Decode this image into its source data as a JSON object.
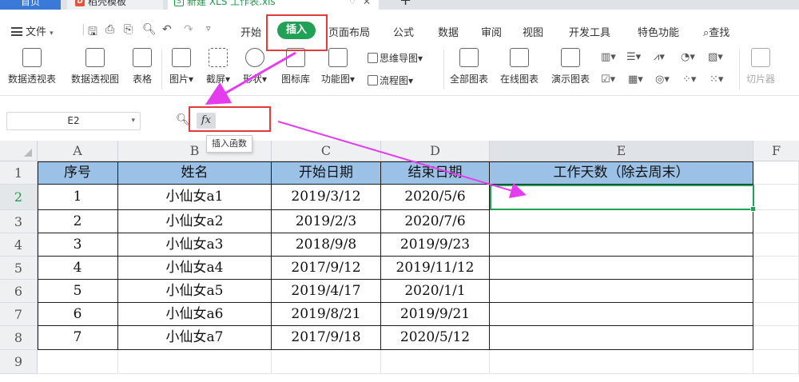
{
  "tabs": {
    "home": "首页",
    "template": "稻壳模板",
    "file": "新建 XLS 工作表.xls",
    "template_logo": "D",
    "file_logo": "S"
  },
  "menu": {
    "file": "文件",
    "items": [
      "开始",
      "插入",
      "页面布局",
      "公式",
      "数据",
      "审阅",
      "视图",
      "开发工具",
      "特色功能",
      "查找"
    ],
    "active": "插入"
  },
  "ribbon": {
    "pivot_table": "数据透视表",
    "pivot_chart": "数据透视图",
    "table": "表格",
    "picture": "图片",
    "screenshot": "截屏",
    "shape": "形状",
    "icon_lib": "图标库",
    "function_chart": "功能图",
    "mind_map": "思维导图",
    "flow_chart": "流程图",
    "all_charts": "全部图表",
    "online_charts": "在线图表",
    "demo_charts": "演示图表",
    "slicer": "切片器"
  },
  "formula_bar": {
    "cell_ref": "E2",
    "fx_label": "fx",
    "formula": "",
    "tooltip": "插入函数"
  },
  "columns": [
    "A",
    "B",
    "C",
    "D",
    "E",
    "F"
  ],
  "rows": [
    "1",
    "2",
    "3",
    "4",
    "5",
    "6",
    "7",
    "8",
    "9"
  ],
  "sheet": {
    "headers": [
      "序号",
      "姓名",
      "开始日期",
      "结束日期",
      "工作天数（除去周末）"
    ],
    "data": [
      [
        "1",
        "小仙女a1",
        "2019/3/12",
        "2020/5/6",
        ""
      ],
      [
        "2",
        "小仙女a2",
        "2019/2/3",
        "2020/7/6",
        ""
      ],
      [
        "3",
        "小仙女a3",
        "2018/9/8",
        "2019/9/23",
        ""
      ],
      [
        "4",
        "小仙女a4",
        "2017/9/12",
        "2019/11/12",
        ""
      ],
      [
        "5",
        "小仙女a5",
        "2019/4/17",
        "2020/1/1",
        ""
      ],
      [
        "6",
        "小仙女a6",
        "2019/8/21",
        "2019/9/21",
        ""
      ],
      [
        "7",
        "小仙女a7",
        "2017/9/18",
        "2020/5/12",
        ""
      ]
    ]
  },
  "selected_cell": "E2",
  "colors": {
    "accent": "#21a155",
    "highlight_box": "#e23b3b",
    "annotation_arrow": "#e43df0",
    "header_fill": "#9bc2e6"
  }
}
